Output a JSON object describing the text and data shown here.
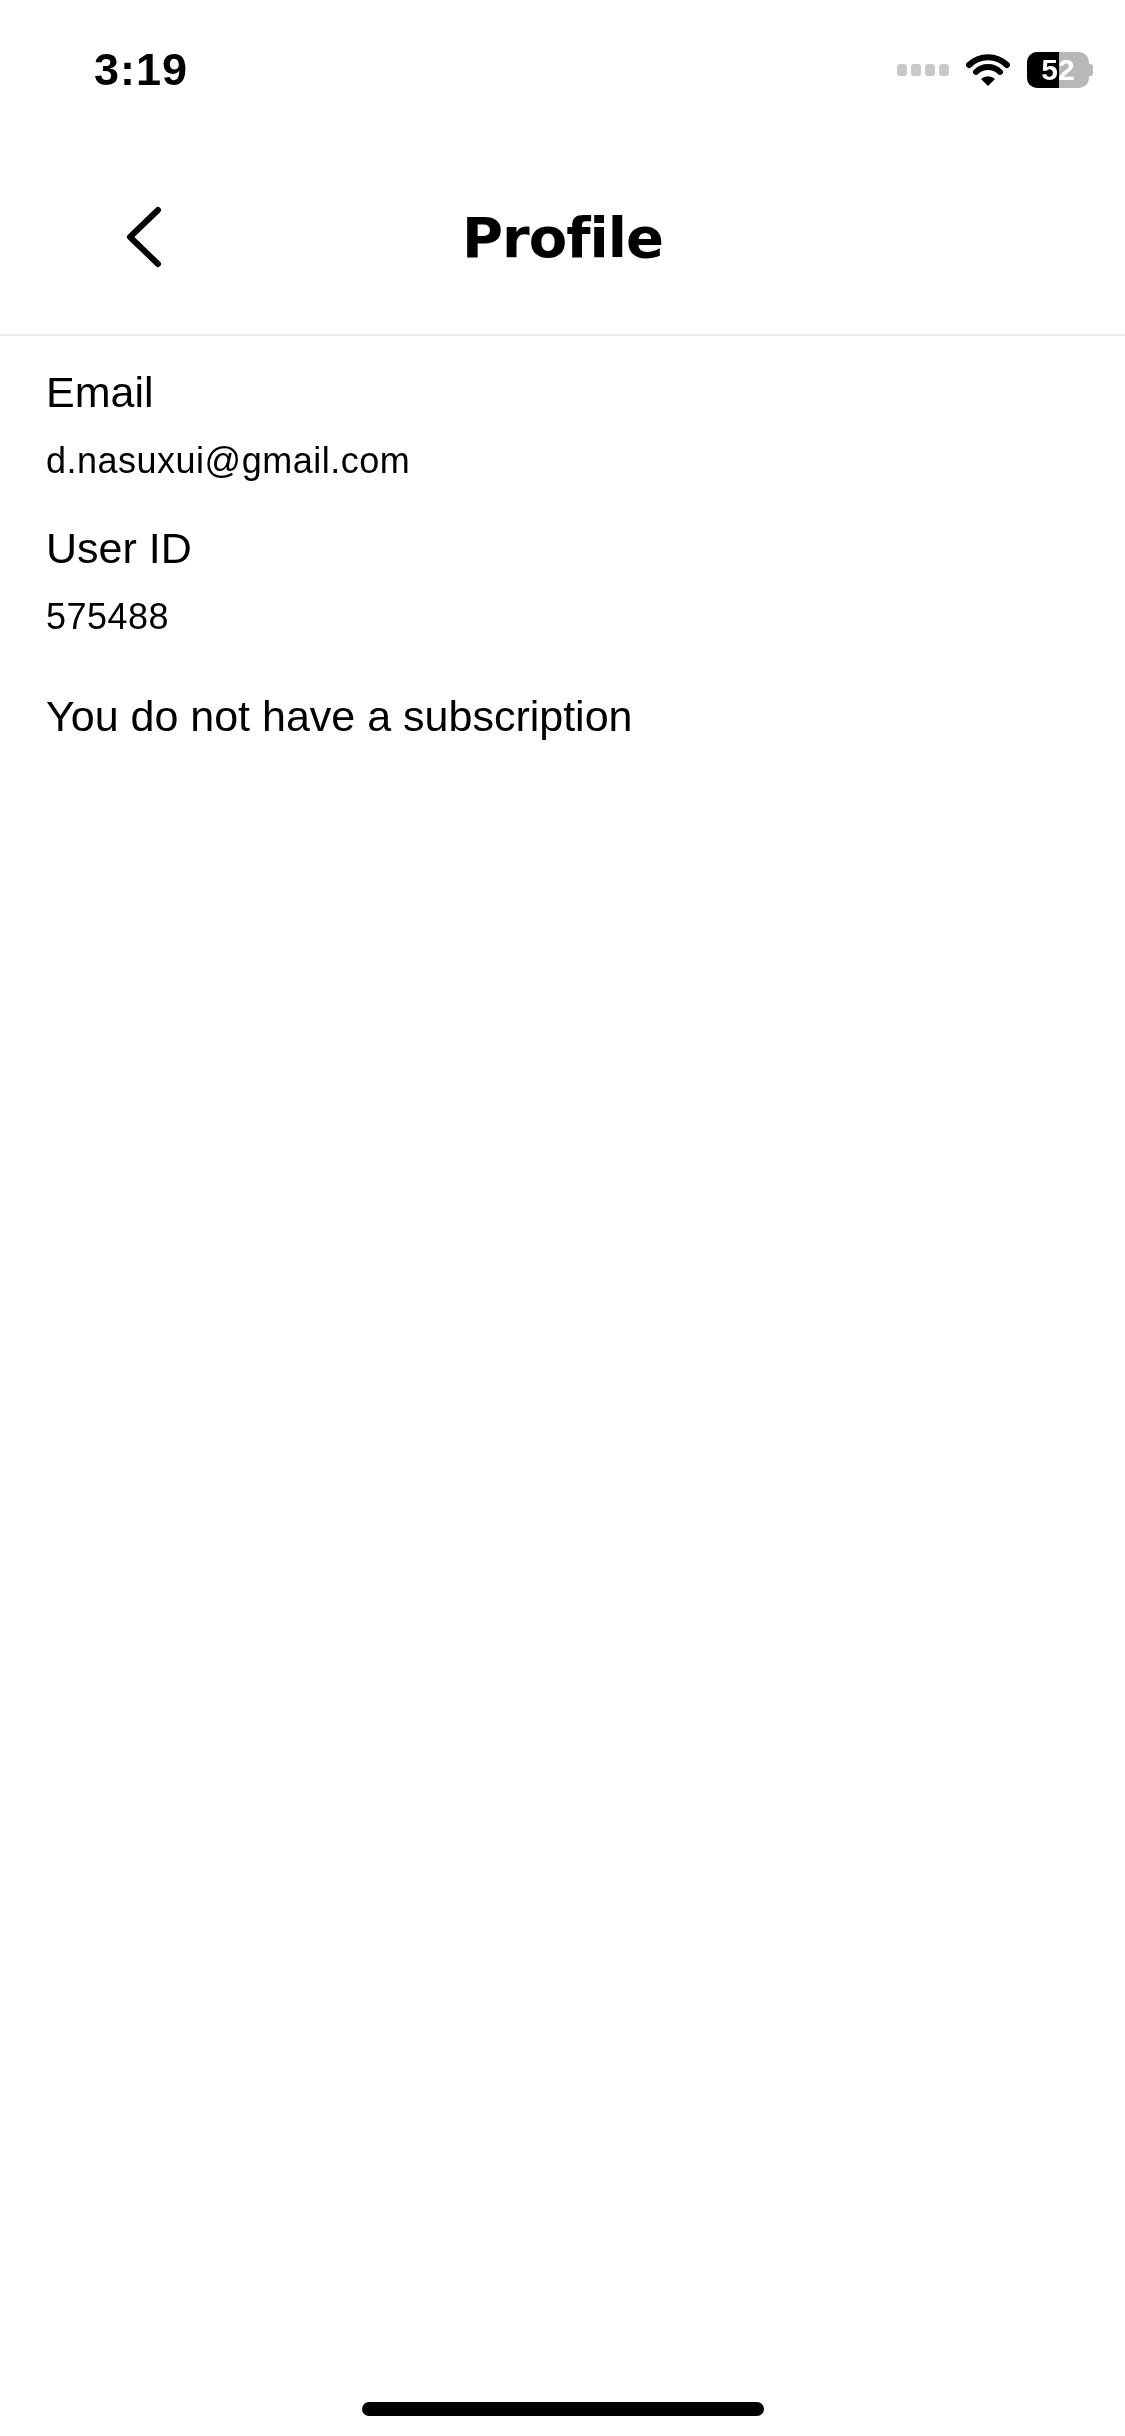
{
  "status_bar": {
    "time": "3:19",
    "battery": "52"
  },
  "header": {
    "title": "Profile"
  },
  "fields": [
    {
      "label": "Email",
      "value": "d.nasuxui@gmail.com"
    },
    {
      "label": "User ID",
      "value": "575488"
    }
  ],
  "subscription_note": "You do not have a subscription"
}
